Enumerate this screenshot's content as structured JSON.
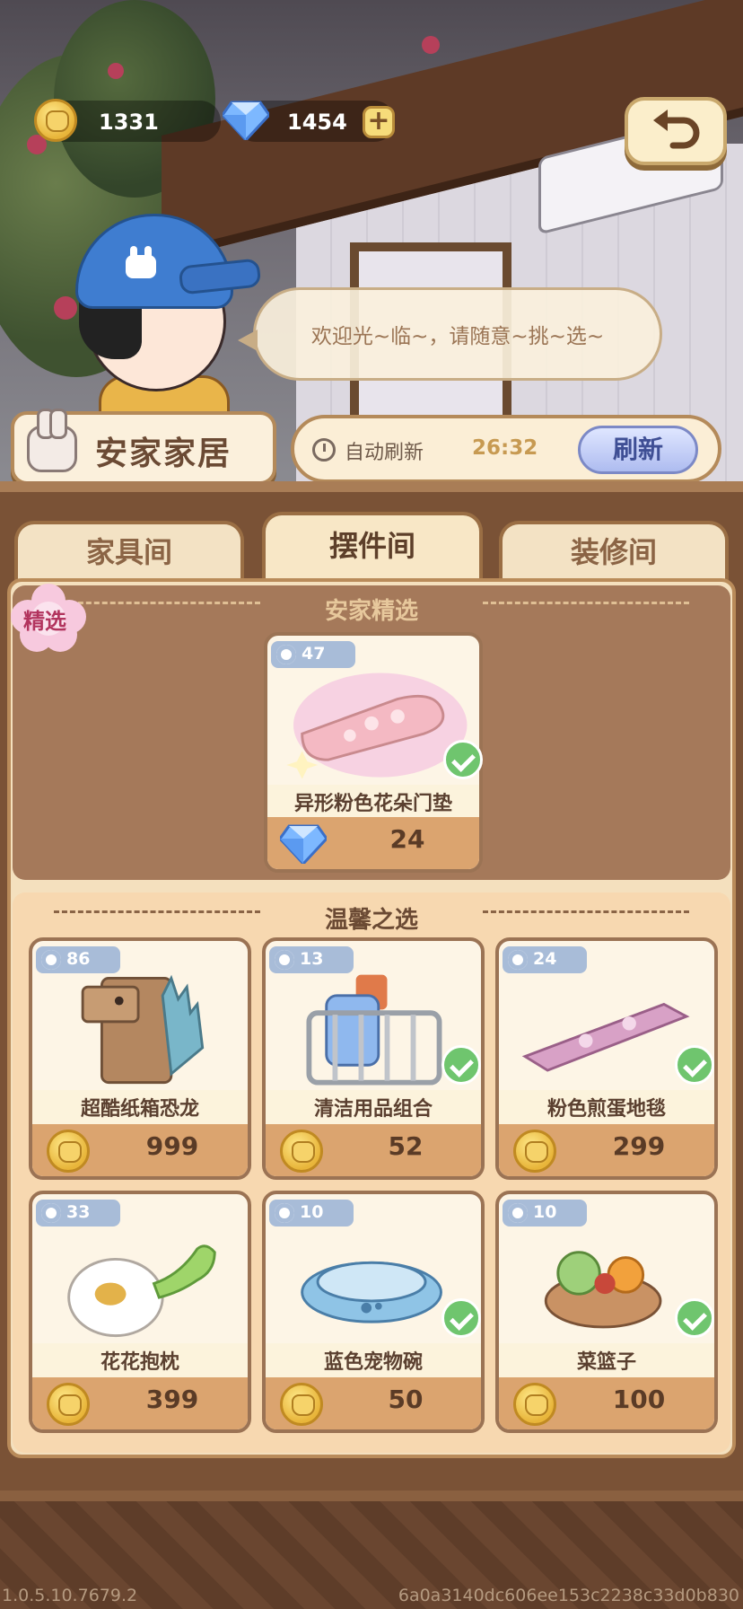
{
  "currency": {
    "coins": "1331",
    "gems": "1454",
    "add_label": "+"
  },
  "npc": {
    "greeting": "欢迎光~临~，请随意~挑~选~"
  },
  "shop": {
    "name": "安家家居",
    "auto_refresh_label": "自动刷新",
    "timer": "26:32",
    "refresh_button": "刷新"
  },
  "tabs": [
    {
      "label": "家具间",
      "active": false
    },
    {
      "label": "摆件间",
      "active": true
    },
    {
      "label": "装修间",
      "active": false
    }
  ],
  "featured": {
    "badge": "精选",
    "title": "安家精选",
    "item": {
      "count": "47",
      "name": "异形粉色花朵门垫",
      "price": "24",
      "currency": "gem",
      "owned": true
    }
  },
  "cozy": {
    "title": "温馨之选",
    "items": [
      {
        "count": "86",
        "name": "超酷纸箱恐龙",
        "price": "999",
        "currency": "coin",
        "owned": false
      },
      {
        "count": "13",
        "name": "清洁用品组合",
        "price": "52",
        "currency": "coin",
        "owned": true
      },
      {
        "count": "24",
        "name": "粉色煎蛋地毯",
        "price": "299",
        "currency": "coin",
        "owned": true
      },
      {
        "count": "33",
        "name": "花花抱枕",
        "price": "399",
        "currency": "coin",
        "owned": false
      },
      {
        "count": "10",
        "name": "蓝色宠物碗",
        "price": "50",
        "currency": "coin",
        "owned": true
      },
      {
        "count": "10",
        "name": "菜篮子",
        "price": "100",
        "currency": "coin",
        "owned": true
      }
    ]
  },
  "footer": {
    "version": "1.0.5.10.7679.2",
    "build_hash": "6a0a3140dc606ee153c2238c33d0b830"
  }
}
